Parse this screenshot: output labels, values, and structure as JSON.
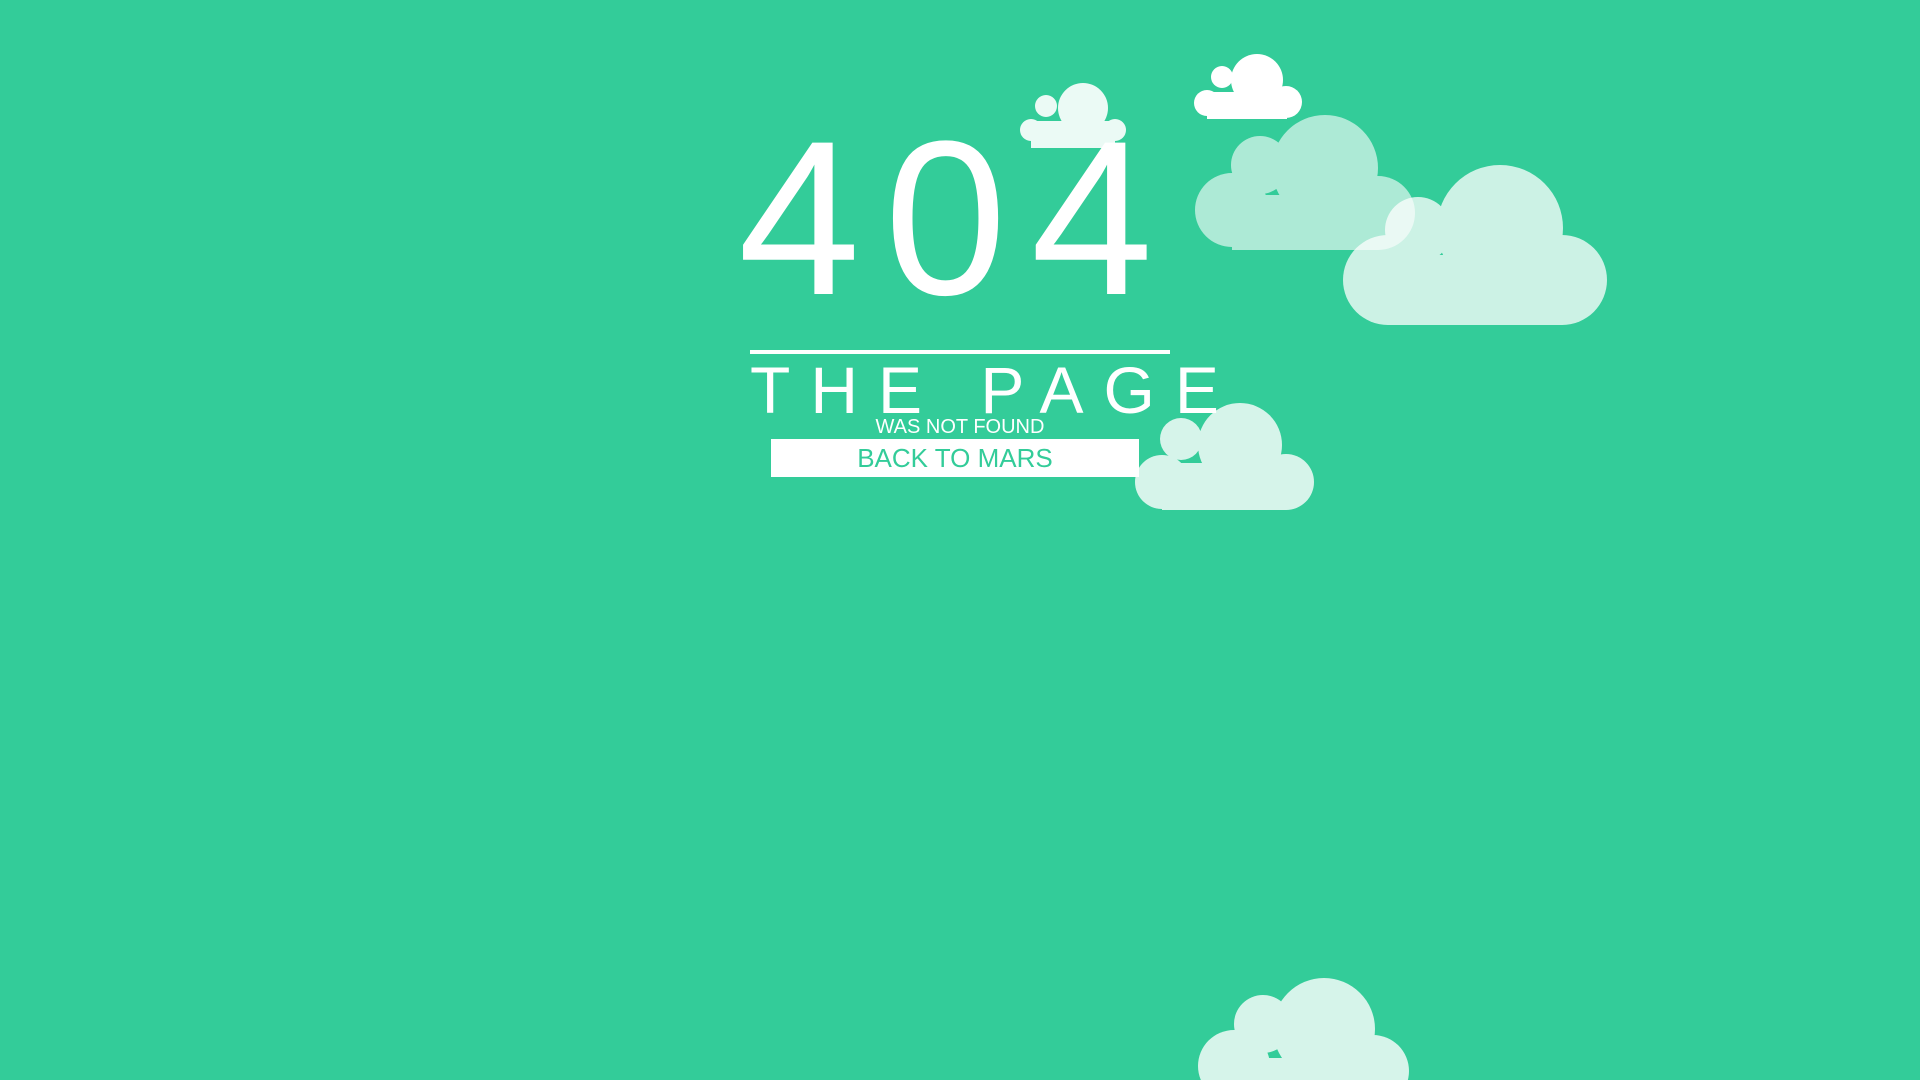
{
  "error": {
    "code": "404",
    "headline": "THE PAGE",
    "subline": "WAS NOT FOUND"
  },
  "actions": {
    "back_label": "BACK TO MARS"
  },
  "theme": {
    "background": "#33cc99",
    "foreground": "#ffffff",
    "button_text": "#33cc99"
  },
  "decorations": {
    "icon": "cloud-icon"
  }
}
